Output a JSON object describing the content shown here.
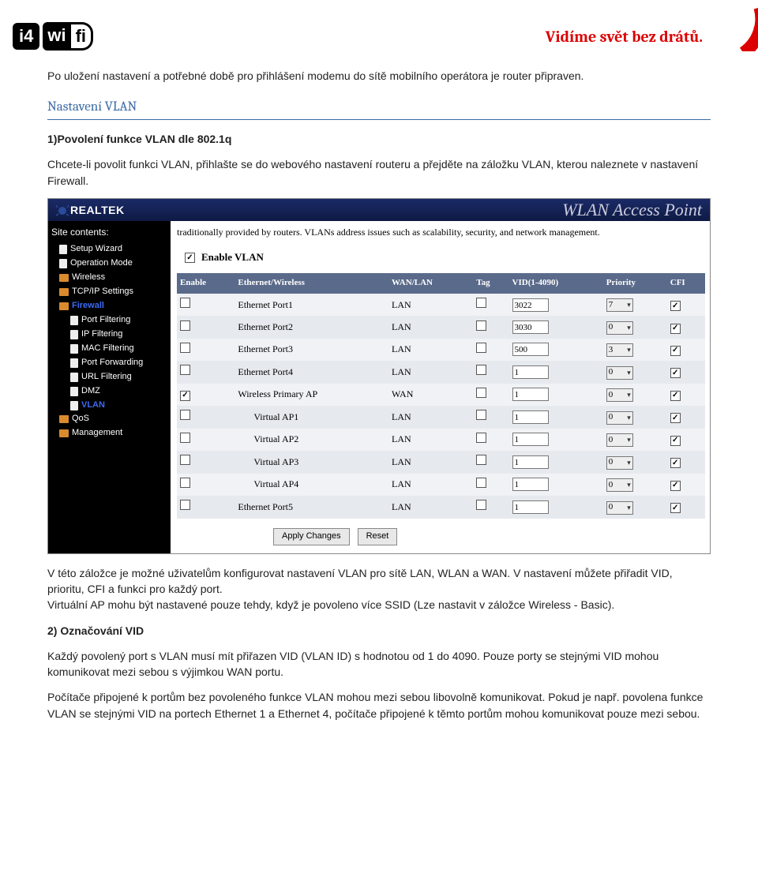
{
  "header": {
    "logo_i4": "i4",
    "logo_wi": "wi",
    "logo_fi": "fi",
    "tagline": "Vidíme svět bez drátů."
  },
  "doc": {
    "para1": "Po uložení nastavení a potřebné době pro přihlášení modemu do sítě mobilního operátora je router připraven.",
    "heading_vlan": "Nastavení VLAN",
    "sub1_title": "1)Povolení funkce VLAN dle 802.1q",
    "sub1_text": "Chcete-li povolit funkci VLAN, přihlašte se do webového nastavení routeru a přejděte na záložku VLAN, kterou naleznete v nastavení Firewall.",
    "after1_a": "V této záložce je možné uživatelům konfigurovat nastavení VLAN pro sítě LAN, WLAN a WAN. V nastavení můžete přiřadit VID, prioritu, CFI a funkci pro každý port.",
    "after1_b": "Virtuální AP mohu být nastavené pouze tehdy, když je povoleno více SSID (Lze nastavit v záložce Wireless - Basic).",
    "sub2_title": "2) Označování VID",
    "sub2_a": "Každý povolený port s VLAN musí mít přiřazen VID (VLAN ID) s hodnotou od 1 do 4090. Pouze porty se stejnými VID mohou komunikovat mezi sebou s výjimkou WAN portu.",
    "sub2_b": "Počítače připojené k portům bez povoleného funkce VLAN mohou mezi sebou libovolně komunikovat. Pokud je např. povolena funkce VLAN se stejnými VID na portech Ethernet 1 a Ethernet 4, počítače připojené k těmto portům mohou komunikovat pouze mezi sebou."
  },
  "shot": {
    "brand": "REALTEK",
    "ap_title": "WLAN Access Point",
    "site_contents": "Site contents:",
    "tree": [
      {
        "label": "Setup Wizard",
        "type": "page",
        "level": 0
      },
      {
        "label": "Operation Mode",
        "type": "page",
        "level": 0
      },
      {
        "label": "Wireless",
        "type": "folder",
        "level": 0
      },
      {
        "label": "TCP/IP Settings",
        "type": "folder",
        "level": 0
      },
      {
        "label": "Firewall",
        "type": "folder",
        "level": 0,
        "active": true
      },
      {
        "label": "Port Filtering",
        "type": "page",
        "level": 1
      },
      {
        "label": "IP Filtering",
        "type": "page",
        "level": 1
      },
      {
        "label": "MAC Filtering",
        "type": "page",
        "level": 1
      },
      {
        "label": "Port Forwarding",
        "type": "page",
        "level": 1
      },
      {
        "label": "URL Filtering",
        "type": "page",
        "level": 1
      },
      {
        "label": "DMZ",
        "type": "page",
        "level": 1
      },
      {
        "label": "VLAN",
        "type": "page",
        "level": 1,
        "active": true
      },
      {
        "label": "QoS",
        "type": "folder",
        "level": 0
      },
      {
        "label": "Management",
        "type": "folder",
        "level": 0
      }
    ],
    "desc": "traditionally provided by routers. VLANs address issues such as scalability, security, and network management.",
    "enable_label": "Enable VLAN",
    "enable_checked": true,
    "columns": [
      "Enable",
      "Ethernet/Wireless",
      "WAN/LAN",
      "Tag",
      "VID(1-4090)",
      "Priority",
      "CFI"
    ],
    "rows": [
      {
        "enable": false,
        "name": "Ethernet Port1",
        "wl": "LAN",
        "tag": false,
        "vid": "3022",
        "prio": "7",
        "cfi": true
      },
      {
        "enable": false,
        "name": "Ethernet Port2",
        "wl": "LAN",
        "tag": false,
        "vid": "3030",
        "prio": "0",
        "cfi": true
      },
      {
        "enable": false,
        "name": "Ethernet Port3",
        "wl": "LAN",
        "tag": false,
        "vid": "500",
        "prio": "3",
        "cfi": true
      },
      {
        "enable": false,
        "name": "Ethernet Port4",
        "wl": "LAN",
        "tag": false,
        "vid": "1",
        "prio": "0",
        "cfi": true
      },
      {
        "enable": true,
        "name": "Wireless Primary AP",
        "wl": "WAN",
        "tag": false,
        "vid": "1",
        "prio": "0",
        "cfi": true
      },
      {
        "enable": false,
        "name": "Virtual AP1",
        "wl": "LAN",
        "tag": false,
        "vid": "1",
        "prio": "0",
        "cfi": true
      },
      {
        "enable": false,
        "name": "Virtual AP2",
        "wl": "LAN",
        "tag": false,
        "vid": "1",
        "prio": "0",
        "cfi": true
      },
      {
        "enable": false,
        "name": "Virtual AP3",
        "wl": "LAN",
        "tag": false,
        "vid": "1",
        "prio": "0",
        "cfi": true
      },
      {
        "enable": false,
        "name": "Virtual AP4",
        "wl": "LAN",
        "tag": false,
        "vid": "1",
        "prio": "0",
        "cfi": true
      },
      {
        "enable": false,
        "name": "Ethernet Port5",
        "wl": "LAN",
        "tag": false,
        "vid": "1",
        "prio": "0",
        "cfi": true
      }
    ],
    "apply": "Apply Changes",
    "reset": "Reset"
  }
}
